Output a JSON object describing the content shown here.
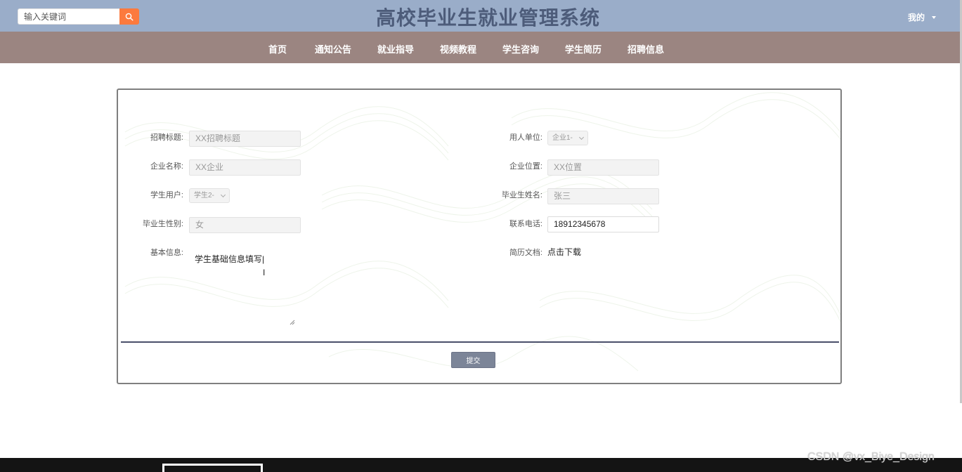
{
  "header": {
    "search_placeholder": "输入关键词",
    "title": "高校毕业生就业管理系统",
    "user_menu_label": "我的"
  },
  "nav": {
    "items": [
      {
        "label": "首页"
      },
      {
        "label": "通知公告"
      },
      {
        "label": "就业指导"
      },
      {
        "label": "视频教程"
      },
      {
        "label": "学生咨询"
      },
      {
        "label": "学生简历"
      },
      {
        "label": "招聘信息"
      }
    ]
  },
  "form": {
    "recruit_title": {
      "label": "招聘标题:",
      "value": "XX招聘标题"
    },
    "employer_unit": {
      "label": "用人单位:",
      "value": "企业1-"
    },
    "company_name": {
      "label": "企业名称:",
      "value": "XX企业"
    },
    "company_location": {
      "label": "企业位置:",
      "value": "XX位置"
    },
    "student_user": {
      "label": "学生用户:",
      "value": "学生2-"
    },
    "graduate_name": {
      "label": "毕业生姓名:",
      "value": "张三"
    },
    "graduate_gender": {
      "label": "毕业生性别:",
      "value": "女"
    },
    "phone": {
      "label": "联系电话:",
      "value": "18912345678"
    },
    "basic_info": {
      "label": "基本信息:",
      "value": "学生基础信息填写"
    },
    "resume_doc": {
      "label": "简历文档:",
      "link_text": "点击下载"
    },
    "submit_label": "提交"
  },
  "watermark": "CSDN @vx_Biye_Design",
  "colors": {
    "header_bg": "#9aadc9",
    "nav_bg": "#9b8581",
    "title_color": "#4d5c7a",
    "search_button": "#fc7a3e",
    "submit_button": "#7c8598",
    "footer_bg": "#141414"
  },
  "icons": {
    "search": "search-icon",
    "user_menu": "caret-down-icon"
  }
}
